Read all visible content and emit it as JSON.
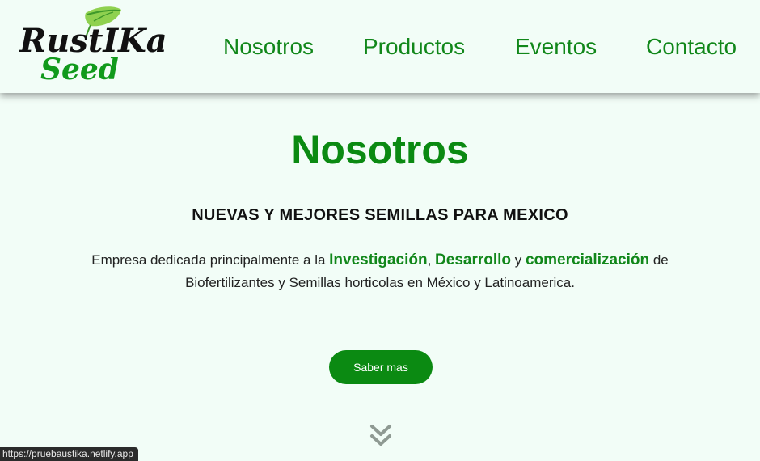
{
  "header": {
    "logo": {
      "line1": "RustIKa",
      "line2": "Seed"
    },
    "nav": [
      {
        "label": "Nosotros"
      },
      {
        "label": "Productos"
      },
      {
        "label": "Eventos"
      },
      {
        "label": "Contacto"
      }
    ]
  },
  "hero": {
    "title": "Nosotros",
    "subtitle": "NUEVAS Y MEJORES SEMILLAS PARA MEXICO",
    "desc": {
      "p1": "Empresa dedicada principalmente a la ",
      "h1": "Investigación",
      "p2": ", ",
      "h2": "Desarrollo",
      "p3": " y ",
      "h3": "comercialización",
      "p4": " de Biofertilizantes y Semillas horticolas en México y Latinoamerica."
    },
    "button": "Saber mas"
  },
  "status_bar": {
    "url": "https://pruebaustika.netlify.app"
  },
  "colors": {
    "brand_green": "#0b8a12",
    "background": "#f2fdf7",
    "leaf_light": "#8fd14f",
    "leaf_dark": "#3f9a2a"
  },
  "icons": {
    "scroll": "double-chevron-down-icon",
    "leaf": "leaf-icon"
  }
}
